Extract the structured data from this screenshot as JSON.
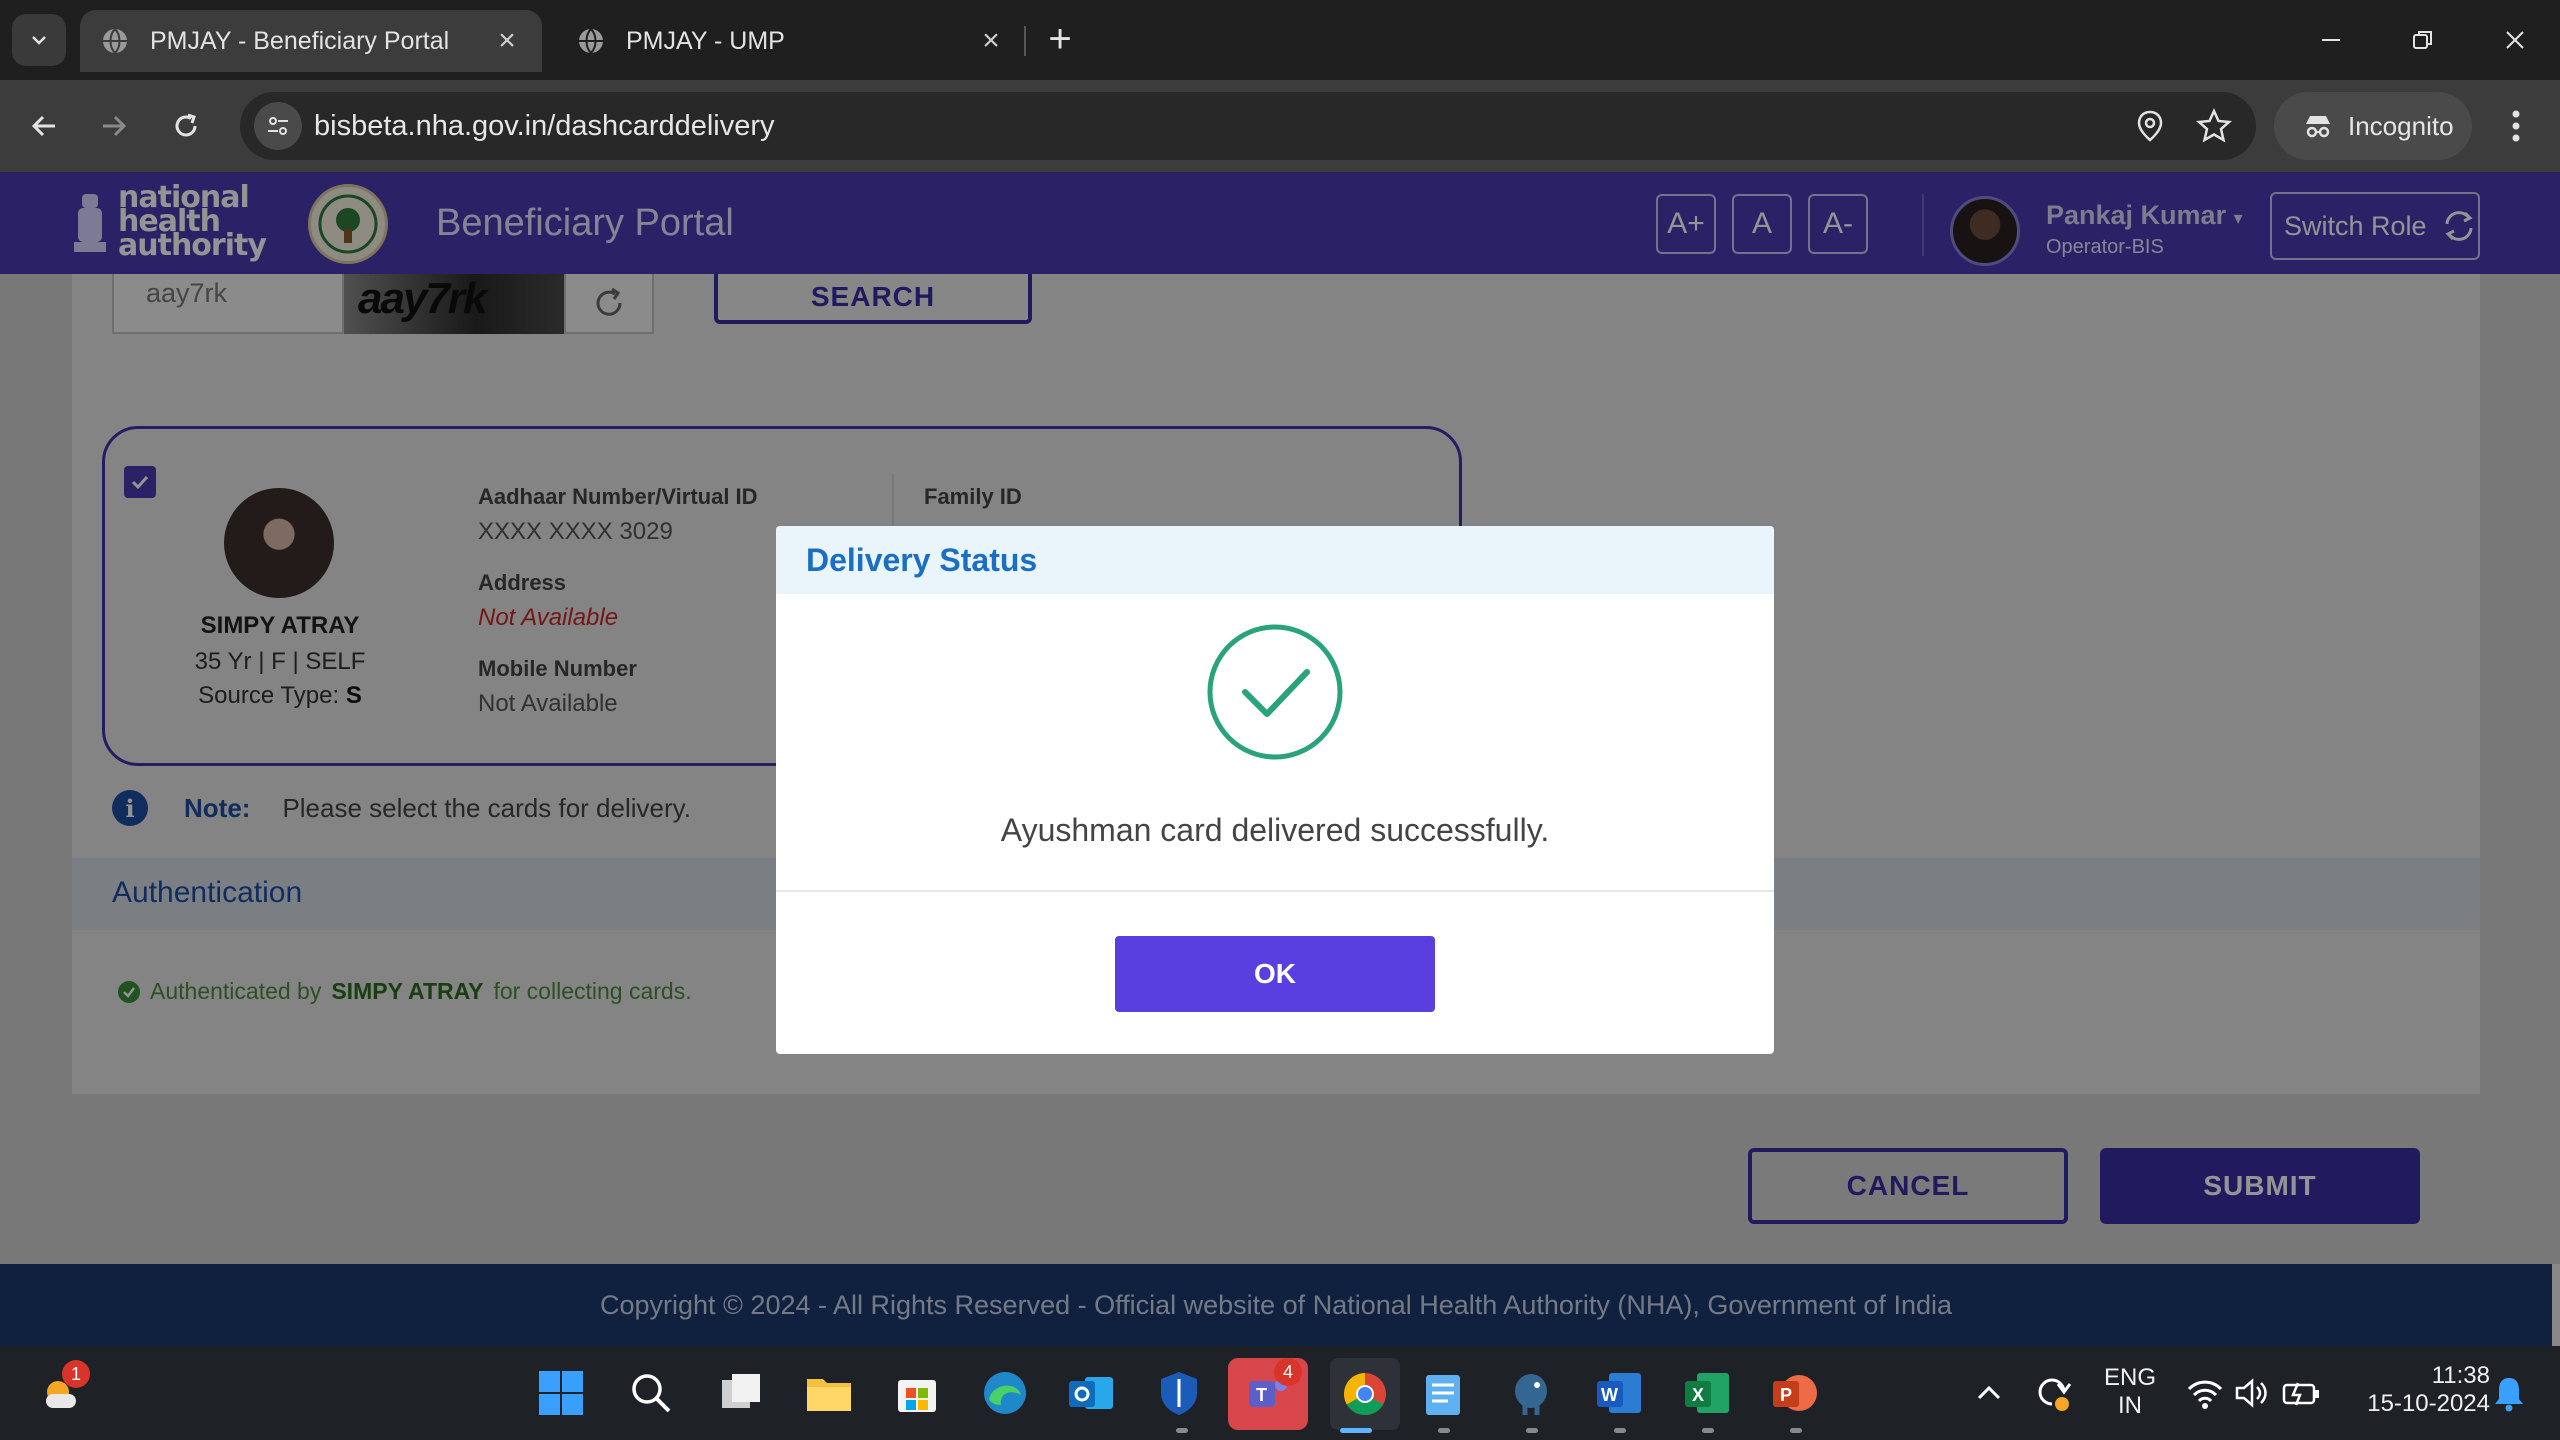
{
  "browser": {
    "tabs": [
      {
        "title": "PMJAY - Beneficiary Portal",
        "active": true
      },
      {
        "title": "PMJAY - UMP",
        "active": false
      }
    ],
    "url": "bisbeta.nha.gov.in/dashcarddelivery",
    "incognito_label": "Incognito"
  },
  "header": {
    "logo_text": [
      "national",
      "health",
      "authority"
    ],
    "portal_title": "Beneficiary Portal",
    "font_controls": [
      "A+",
      "A",
      "A-"
    ],
    "user_name": "Pankaj Kumar",
    "user_role": "Operator-BIS",
    "switch_role_label": "Switch Role"
  },
  "captcha": {
    "input_value": "aay7rk",
    "image_text": "aay7rk",
    "search_label": "SEARCH"
  },
  "member": {
    "checked": true,
    "name": "SIMPY ATRAY",
    "meta": "35 Yr | F | SELF",
    "source_type_label": "Source Type:",
    "source_type_value": "S",
    "aadhaar_label": "Aadhaar Number/Virtual ID",
    "aadhaar_value": "XXXX XXXX 3029",
    "address_label": "Address",
    "address_value": "Not Available",
    "mobile_label": "Mobile Number",
    "mobile_value": "Not Available",
    "family_id_label": "Family ID"
  },
  "note": {
    "label": "Note:",
    "text": "Please select the cards for delivery."
  },
  "authentication": {
    "title": "Authentication",
    "msg_prefix": "Authenticated by",
    "msg_name": "SIMPY ATRAY",
    "msg_suffix": "for collecting cards."
  },
  "actions": {
    "cancel_label": "CANCEL",
    "submit_label": "SUBMIT"
  },
  "footer": {
    "text": "Copyright © 2024 - All Rights Reserved - Official website of National Health Authority (NHA), Government of India"
  },
  "modal": {
    "title": "Delivery Status",
    "message": "Ayushman card delivered successfully.",
    "ok_label": "OK"
  },
  "taskbar": {
    "weather_badge": "1",
    "teams_badge": "4",
    "language": "ENG",
    "region": "IN",
    "time": "11:38",
    "date": "15-10-2024"
  },
  "colors": {
    "brand": "#4a3ab0",
    "primary_button": "#3b2ea3",
    "modal_ok": "#5a3fe0",
    "success": "#2aa37a",
    "footer": "#1c3a6e"
  }
}
